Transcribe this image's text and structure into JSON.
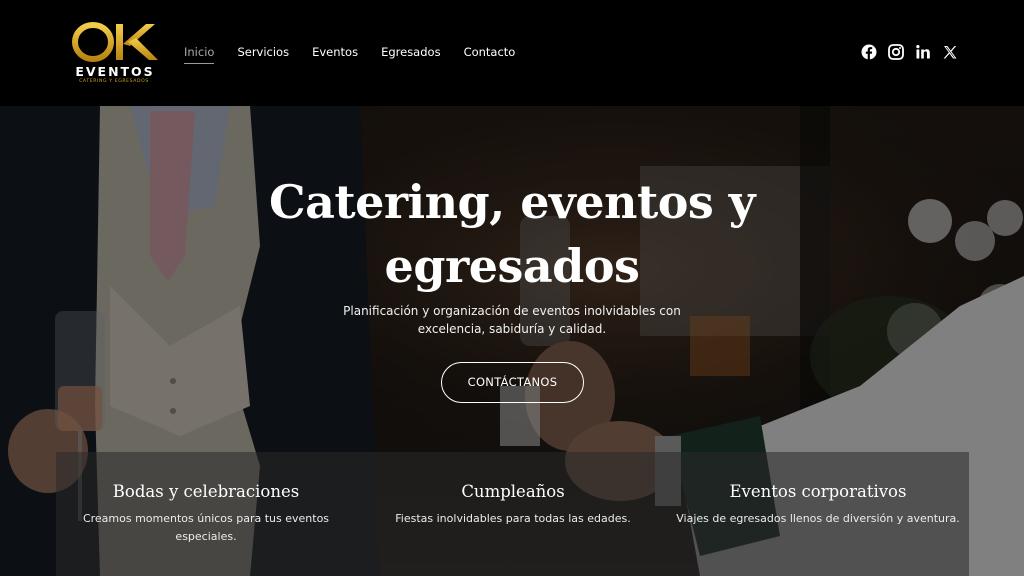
{
  "brand": {
    "logo_mark": "OK",
    "logo_word": "EVENTOS",
    "logo_tagline": "CATERING Y EGRESADOS",
    "gold": "#d4a418"
  },
  "nav": {
    "items": [
      {
        "label": "Inicio",
        "active": true
      },
      {
        "label": "Servicios",
        "active": false
      },
      {
        "label": "Eventos",
        "active": false
      },
      {
        "label": "Egresados",
        "active": false
      },
      {
        "label": "Contacto",
        "active": false
      }
    ]
  },
  "social": [
    "facebook-icon",
    "instagram-icon",
    "linkedin-icon",
    "x-icon"
  ],
  "hero": {
    "title": "Catering, eventos y egresados",
    "subtitle": "Planificación y organización de eventos inolvidables con excelencia, sabiduría y calidad.",
    "cta_label": "CONTÁCTANOS"
  },
  "features": [
    {
      "title": "Bodas y celebraciones",
      "text": "Creamos momentos únicos para tus eventos especiales."
    },
    {
      "title": "Cumpleaños",
      "text": "Fiestas inolvidables para todas las edades."
    },
    {
      "title": "Eventos corporativos",
      "text": "Viajes de egresados llenos de diversión y aventura."
    }
  ]
}
